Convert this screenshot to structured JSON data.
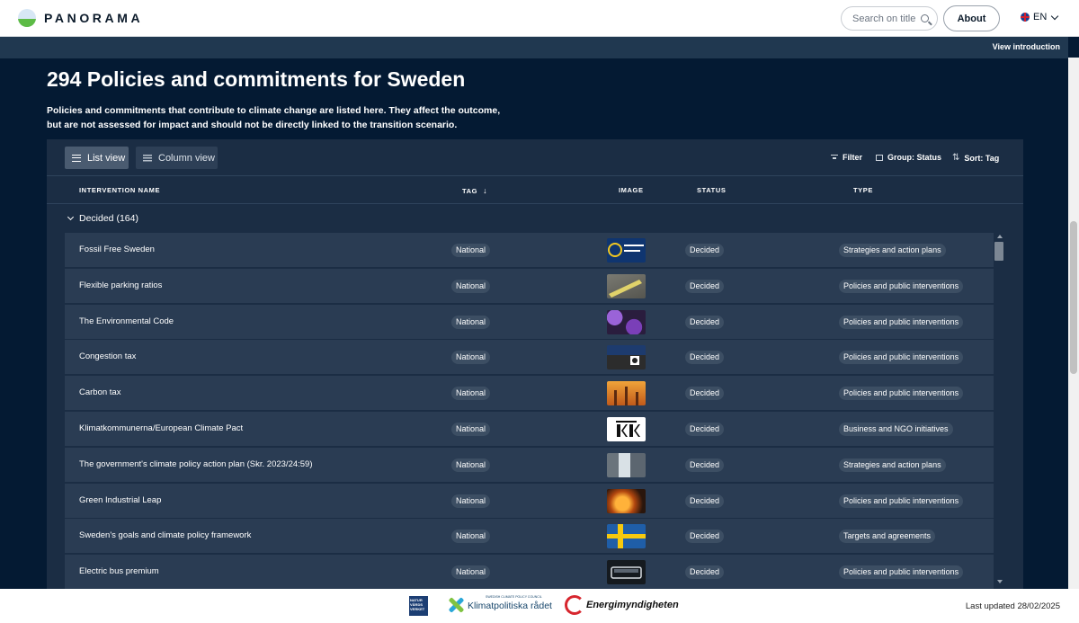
{
  "header": {
    "logo_text": "PANORAMA",
    "search_placeholder": "Search on title",
    "about_label": "About",
    "language": "EN"
  },
  "band": {
    "view_intro_label": "View introduction"
  },
  "page": {
    "title": "294 Policies and commitments for Sweden",
    "description": "Policies and commitments that contribute to climate change are listed here. They affect the outcome, but are not assessed for impact and should not be directly linked to the transition scenario."
  },
  "toolbar": {
    "list_view_label": "List view",
    "column_view_label": "Column view",
    "filter_label": "Filter",
    "group_label": "Group: Status",
    "sort_label": "Sort: Tag"
  },
  "table": {
    "columns": [
      "INTERVENTION NAME",
      "TAG",
      "IMAGE",
      "STATUS",
      "TYPE"
    ],
    "group_label": "Decided (164)",
    "rows": [
      {
        "name": "Fossil Free Sweden",
        "tag": "National",
        "status": "Decided",
        "type": "Strategies and action plans",
        "thumb": "fossil-free-sweden-logo"
      },
      {
        "name": "Flexible parking ratios",
        "tag": "National",
        "status": "Decided",
        "type": "Policies and public interventions",
        "thumb": "road-marking-photo"
      },
      {
        "name": "The Environmental Code",
        "tag": "National",
        "status": "Decided",
        "type": "Policies and public interventions",
        "thumb": "purple-flowers-photo"
      },
      {
        "name": "Congestion tax",
        "tag": "National",
        "status": "Decided",
        "type": "Policies and public interventions",
        "thumb": "city-traffic-photo"
      },
      {
        "name": "Carbon tax",
        "tag": "National",
        "status": "Decided",
        "type": "Policies and public interventions",
        "thumb": "smokestack-photo"
      },
      {
        "name": "Klimatkommunerna/European Climate Pact",
        "tag": "National",
        "status": "Decided",
        "type": "Business and NGO initiatives",
        "thumb": "klimatkommunerna-logo"
      },
      {
        "name": "The government's climate policy action plan (Skr. 2023/24:59)",
        "tag": "National",
        "status": "Decided",
        "type": "Strategies and action plans",
        "thumb": "waterfall-photo"
      },
      {
        "name": "Green Industrial Leap",
        "tag": "National",
        "status": "Decided",
        "type": "Policies and public interventions",
        "thumb": "molten-steel-photo"
      },
      {
        "name": "Sweden's goals and climate policy framework",
        "tag": "National",
        "status": "Decided",
        "type": "Targets and agreements",
        "thumb": "swedish-flag"
      },
      {
        "name": "Electric bus premium",
        "tag": "National",
        "status": "Decided",
        "type": "Policies and public interventions",
        "thumb": "bus-photo"
      }
    ]
  },
  "footer": {
    "naturvard_text": "NATUR VÅRDS VERKET",
    "klima_text": "Klimatpolitiska rådet",
    "klima_sub": "SWEDISH CLIMATE POLICY COUNCIL",
    "energi_text": "Energimyndigheten",
    "last_updated": "Last updated 28/02/2025"
  },
  "colors": {
    "background": "#041a33",
    "panel": "#1b2d44",
    "row": "#2a3c53",
    "pill": "#3c4e63",
    "band": "#203850"
  }
}
